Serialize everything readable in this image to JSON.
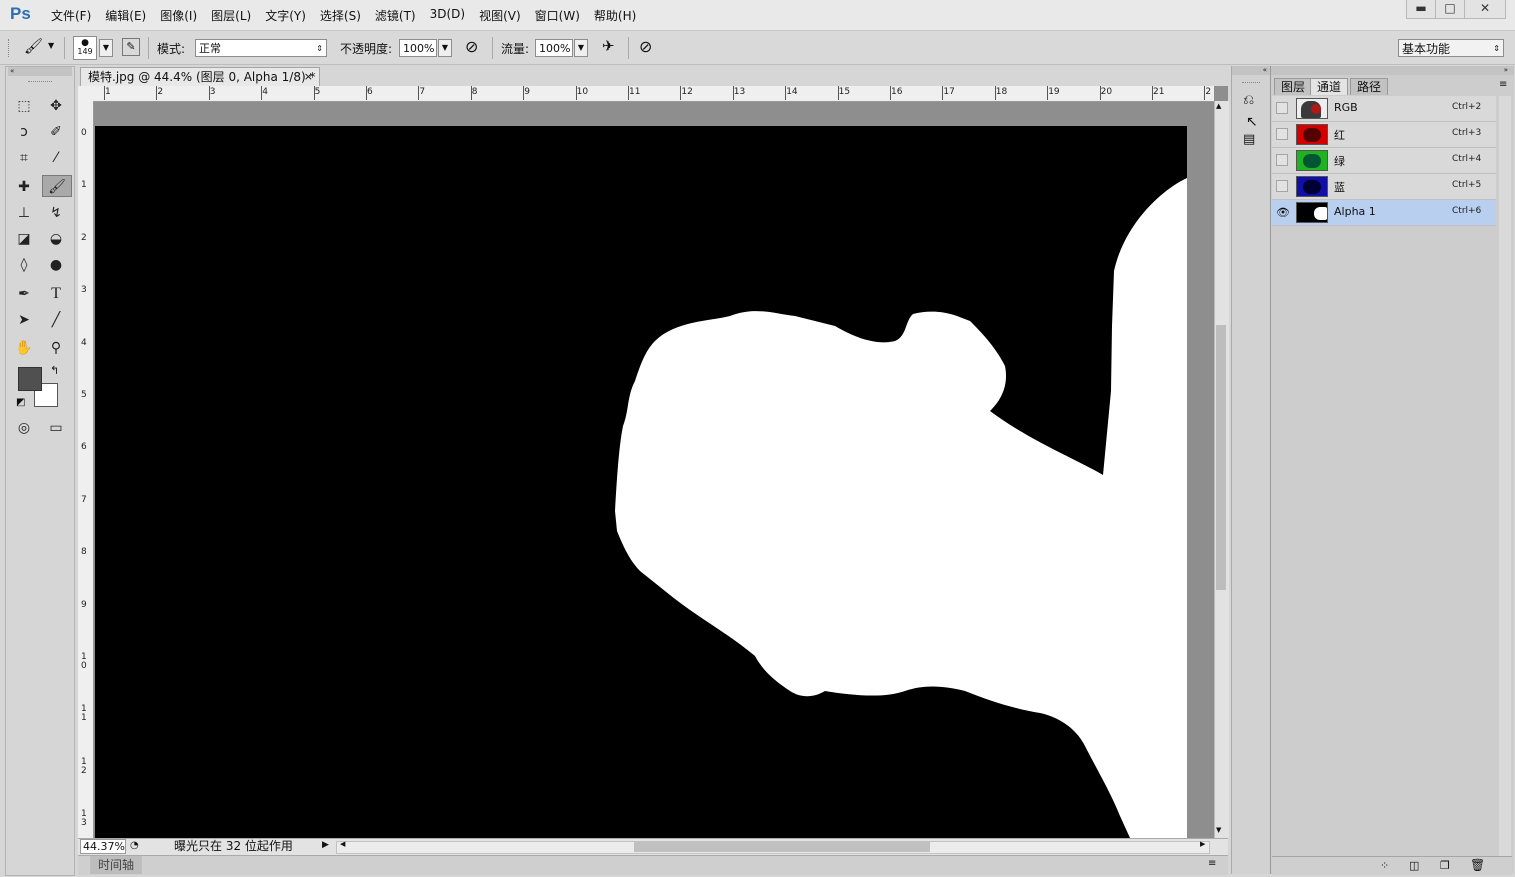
{
  "app": {
    "logo": "Ps"
  },
  "menu": [
    "文件(F)",
    "编辑(E)",
    "图像(I)",
    "图层(L)",
    "文字(Y)",
    "选择(S)",
    "滤镜(T)",
    "3D(D)",
    "视图(V)",
    "窗口(W)",
    "帮助(H)"
  ],
  "window_controls": {
    "minimize": "▬",
    "maximize": "□",
    "close": "✕"
  },
  "options": {
    "brush_size": "149",
    "mode_label": "模式:",
    "mode_value": "正常",
    "opacity_label": "不透明度:",
    "opacity_value": "100%",
    "flow_label": "流量:",
    "flow_value": "100%",
    "workspace": "基本功能"
  },
  "document": {
    "tab_title": "模特.jpg @ 44.4% (图层 0, Alpha 1/8) *",
    "tab_close": "×",
    "zoom": "44.37%",
    "status_text": "曝光只在 32 位起作用",
    "timeline_label": "时间轴",
    "ruler_top": [
      "1",
      "2",
      "3",
      "4",
      "5",
      "6",
      "7",
      "8",
      "9",
      "10",
      "11",
      "12",
      "13",
      "14",
      "15",
      "16",
      "17",
      "18",
      "19",
      "20",
      "21",
      "2"
    ],
    "ruler_left": [
      "0",
      "1",
      "2",
      "3",
      "4",
      "5",
      "6",
      "7",
      "8",
      "9",
      "10",
      "11",
      "12",
      "13"
    ]
  },
  "panel": {
    "tabs": [
      "图层",
      "通道",
      "路径"
    ],
    "active_tab": "通道",
    "channels": [
      {
        "name": "RGB",
        "shortcut": "Ctrl+2",
        "thumb": "rgb",
        "visible": false,
        "selected": false
      },
      {
        "name": "红",
        "shortcut": "Ctrl+3",
        "thumb": "red",
        "visible": false,
        "selected": false
      },
      {
        "name": "绿",
        "shortcut": "Ctrl+4",
        "thumb": "green",
        "visible": false,
        "selected": false
      },
      {
        "name": "蓝",
        "shortcut": "Ctrl+5",
        "thumb": "blue",
        "visible": false,
        "selected": false
      },
      {
        "name": "Alpha 1",
        "shortcut": "Ctrl+6",
        "thumb": "alpha",
        "visible": true,
        "selected": true
      }
    ]
  },
  "colors": {
    "fg": "#505050",
    "bg": "#ffffff",
    "selection": "#b9cfef"
  }
}
